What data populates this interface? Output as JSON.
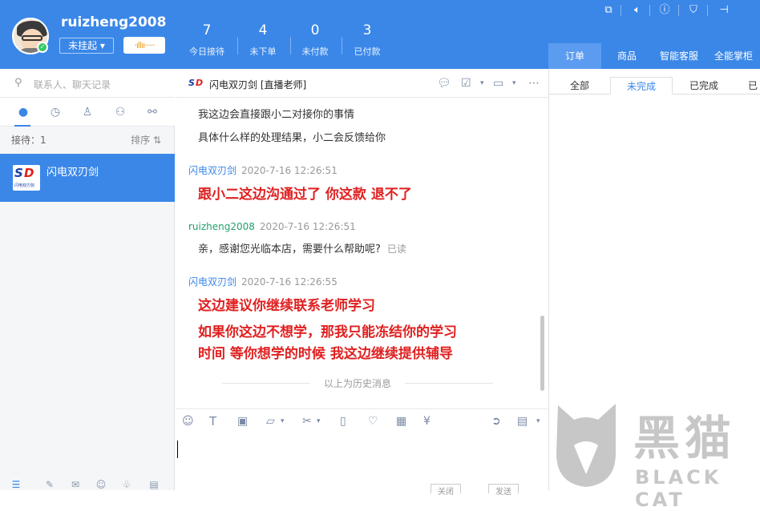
{
  "header": {
    "username": "ruizheng2008",
    "status": "未挂起 ▾",
    "voice": "·ıllıı·····",
    "stats": [
      {
        "value": "7",
        "label": "今日接待"
      },
      {
        "value": "4",
        "label": "未下单"
      },
      {
        "value": "0",
        "label": "未付款"
      },
      {
        "value": "3",
        "label": "已付款"
      }
    ],
    "right_tabs": [
      "订单",
      "商品",
      "智能客服",
      "全能掌柜"
    ]
  },
  "left": {
    "search_placeholder": "联系人、聊天记录",
    "waiting": "接待：1",
    "sort": "排序 ⇅",
    "conversation": {
      "name": "闪电双刃剑",
      "logo_tag": "闪电双刃剑"
    }
  },
  "chat": {
    "title": "闪电双刃剑 [直播老师]",
    "line1": "我这边会直接跟小二对接你的事情",
    "line2": "具体什么样的处理结果，小二会反馈给你",
    "msg1": {
      "name": "闪电双刃剑",
      "time": "2020-7-16 12:26:51",
      "text": "跟小二这边沟通过了  你这款 退不了"
    },
    "msg2": {
      "name": "ruizheng2008",
      "time": "2020-7-16 12:26:51",
      "text": "亲，感谢您光临本店，需要什么帮助呢?",
      "read": "已读"
    },
    "msg3": {
      "name": "闪电双刃剑",
      "time": "2020-7-16 12:26:55",
      "text1": "这边建议你继续联系老师学习",
      "text2": "如果你这边不想学，那我只能冻结你的学习",
      "text3": "时间   等你想学的时候  我这边继续提供辅导"
    },
    "history": "以上为历史消息",
    "close_hint": "关闭",
    "send_hint": "发送"
  },
  "right": {
    "sub_tabs": [
      "全部",
      "未完成",
      "已完成",
      "已"
    ]
  },
  "watermark": {
    "cn": "黑猫",
    "en": "BLACK CAT"
  }
}
